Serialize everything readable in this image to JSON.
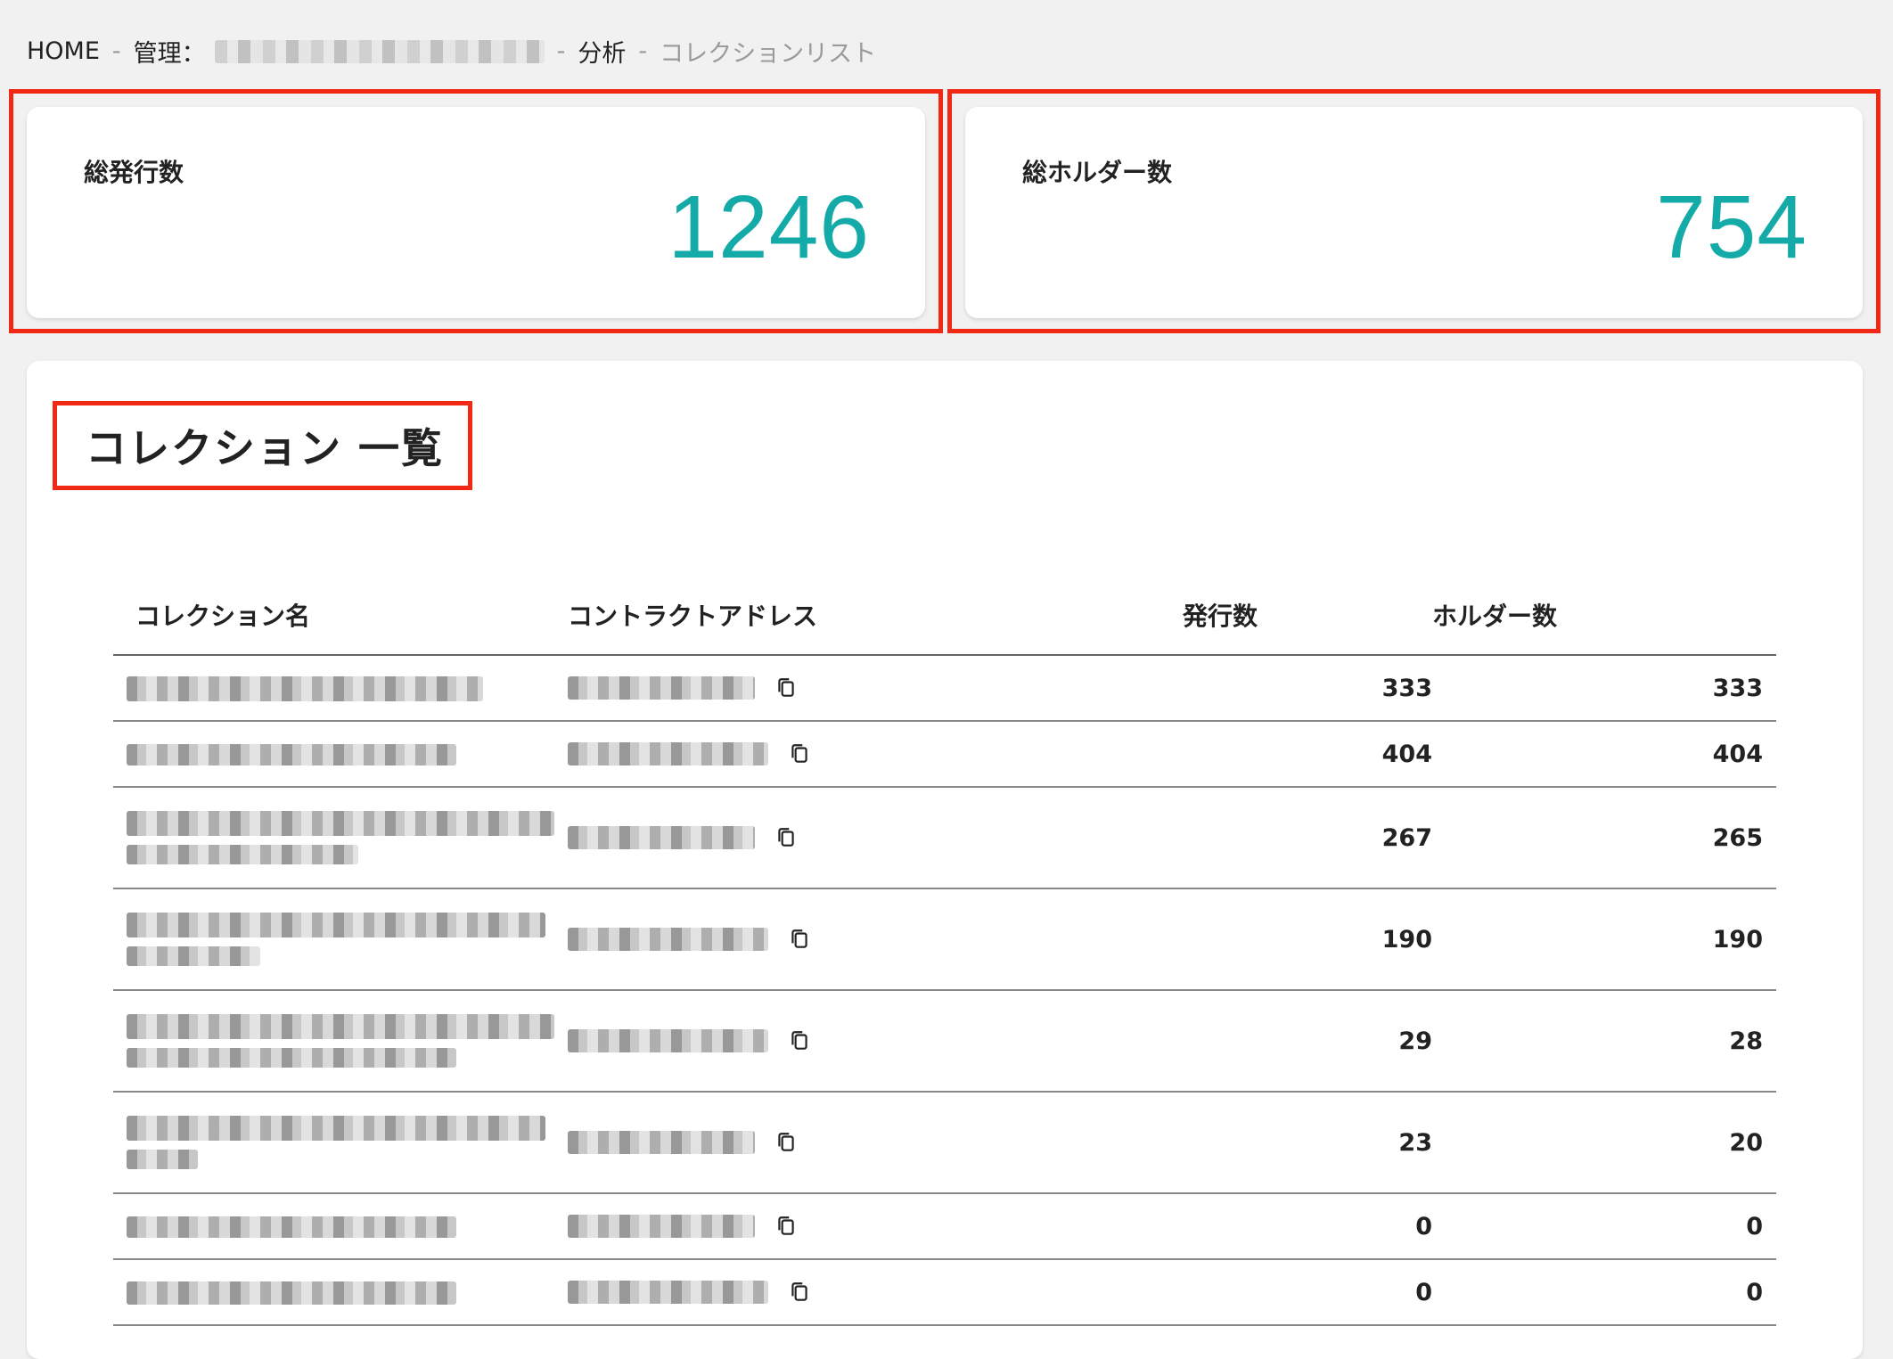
{
  "breadcrumb": {
    "home": "HOME",
    "manage": "管理：",
    "analytics": "分析",
    "current": "コレクションリスト",
    "separator": "-"
  },
  "stats": {
    "total_issued": {
      "label": "総発行数",
      "value": "1246"
    },
    "total_holders": {
      "label": "総ホルダー数",
      "value": "754"
    }
  },
  "collections": {
    "title": "コレクション 一覧",
    "columns": {
      "name": "コレクション名",
      "address": "コントラクトアドレス",
      "issued": "発行数",
      "holders": "ホルダー数"
    },
    "rows": [
      {
        "issued": "333",
        "holders": "333"
      },
      {
        "issued": "404",
        "holders": "404"
      },
      {
        "issued": "267",
        "holders": "265"
      },
      {
        "issued": "190",
        "holders": "190"
      },
      {
        "issued": "29",
        "holders": "28"
      },
      {
        "issued": "23",
        "holders": "20"
      },
      {
        "issued": "0",
        "holders": "0"
      },
      {
        "issued": "0",
        "holders": "0"
      }
    ]
  },
  "icons": {
    "copy": "copy-icon"
  },
  "colors": {
    "accent": "#13aaa8",
    "highlight": "#f02814"
  }
}
